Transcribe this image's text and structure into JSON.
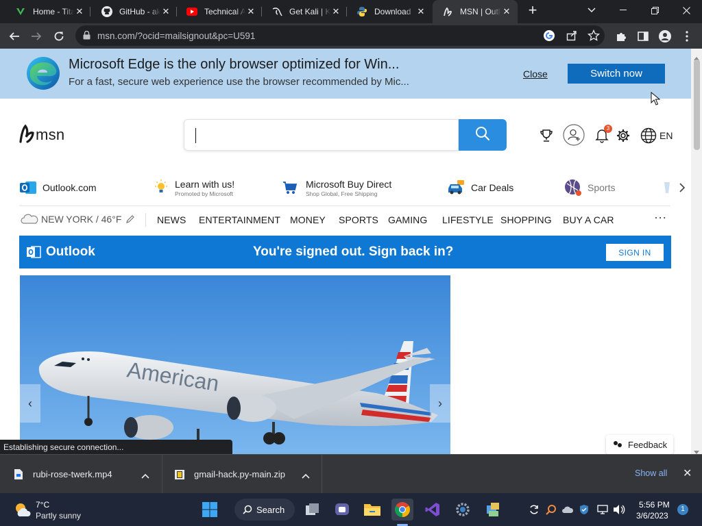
{
  "tabs": [
    {
      "title": "Home - Tita",
      "icon": "titan-favicon-icon",
      "active": false
    },
    {
      "title": "GitHub - ak",
      "icon": "github-icon",
      "active": false
    },
    {
      "title": "Technical A",
      "icon": "youtube-icon",
      "active": false
    },
    {
      "title": "Get Kali | K",
      "icon": "kali-icon",
      "active": false
    },
    {
      "title": "Download",
      "icon": "python-icon",
      "active": false
    },
    {
      "title": "MSN | Outl",
      "icon": "msn-icon",
      "active": true
    }
  ],
  "address_bar": {
    "url": "msn.com/?ocid=mailsignout&pc=U591"
  },
  "edge_banner": {
    "title": "Microsoft Edge is the only browser optimized for Win...",
    "subtitle": "For a fast, secure web experience use the browser recommended by Mic...",
    "close_label": "Close",
    "switch_label": "Switch now"
  },
  "msn": {
    "logo": "msn",
    "header_lang": "EN",
    "notification_count": "3"
  },
  "quick_links": [
    {
      "label": "Outlook.com",
      "sub": ""
    },
    {
      "label": "Learn with us!",
      "sub": "Promoted by Microsoft"
    },
    {
      "label": "Microsoft Buy Direct",
      "sub": "Shop Global, Free Shipping"
    },
    {
      "label": "Car Deals",
      "sub": ""
    },
    {
      "label": "Sports",
      "sub": ""
    }
  ],
  "weather_nav": "NEW YORK / 46°F",
  "categories": [
    "NEWS",
    "ENTERTAINMENT",
    "MONEY",
    "SPORTS",
    "GAMING",
    "LIFESTYLE",
    "SHOPPING",
    "BUY A CAR"
  ],
  "more_label": "···",
  "outlook_bar": {
    "name": "Outlook",
    "message": "You're signed out. Sign back in?",
    "button": "SIGN IN"
  },
  "hero": {
    "plane_text": "American"
  },
  "feedback_label": "Feedback",
  "status_text": "Establishing secure connection...",
  "downloads": [
    {
      "name": "rubi-rose-twerk.mp4"
    },
    {
      "name": "gmail-hack.py-main.zip"
    }
  ],
  "show_all": "Show all",
  "taskbar": {
    "weather_temp": "7°C",
    "weather_desc": "Partly sunny",
    "search_label": "Search",
    "time": "5:56 PM",
    "date": "3/6/2023",
    "notification_badge": "1"
  },
  "colors": {
    "chrome_dark": "#202124",
    "chrome_toolbar": "#35363a",
    "edge_banner": "#b3d3ef",
    "edge_button": "#0f6cbd",
    "msn_search_button": "#2b8de0",
    "outlook_blue": "#0f78d4",
    "taskbar": "#1f2637"
  }
}
